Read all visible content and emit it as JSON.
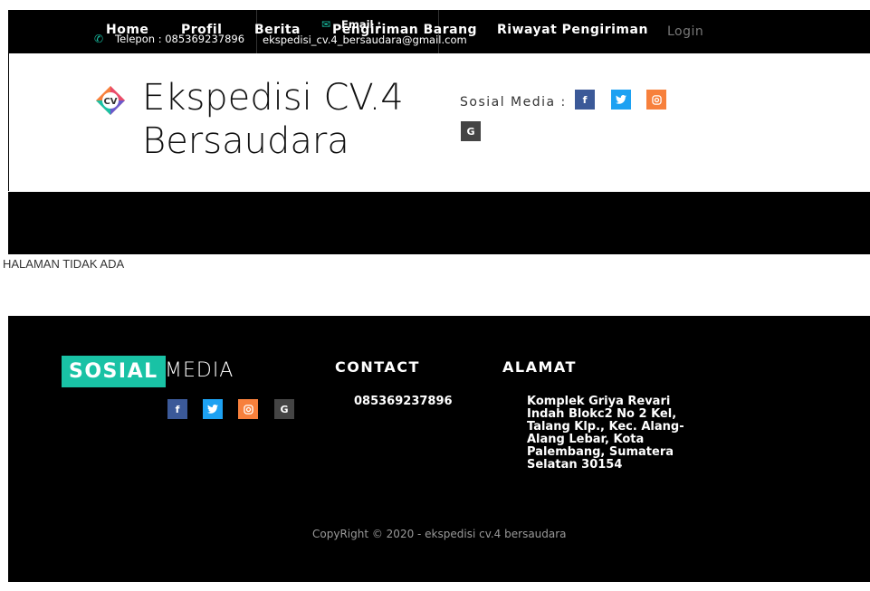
{
  "topbar": {
    "phone_label": "Telepon : 085369237896",
    "email_label": "Email :",
    "email_value": "ekspedisi_cv.4_bersaudara@gmail.com"
  },
  "header": {
    "logo_text": "CV",
    "brand_line1": "Ekspedisi CV.4",
    "brand_line2": "Bersaudara",
    "social_label": "Sosial Media :",
    "social_icons": [
      "f",
      "t",
      "ig",
      "G"
    ]
  },
  "nav": {
    "items": [
      "Home",
      "Profil",
      "Berita",
      "Pengiriman Barang",
      "Riwayat Pengiriman"
    ],
    "login": "Login"
  },
  "content": {
    "message": "HALAMAN TIDAK ADA"
  },
  "footer": {
    "sosial_word": "SOSIAL",
    "media_word": "MEDIA",
    "contact_heading": "CONTACT",
    "contact_phone": "085369237896",
    "alamat_heading": "ALAMAT",
    "alamat_lines": [
      "Komplek Griya Revari",
      "Indah Blokc2 No 2 Kel,",
      "Talang Klp., Kec. Alang-",
      "Alang Lebar, Kota",
      "Palembang, Sumatera",
      "Selatan 30154"
    ],
    "copyright": "CopyRight © 2020 - ekspedisi cv.4 bersaudara"
  },
  "colors": {
    "accent": "#19c2a5",
    "facebook": "#3b5998",
    "twitter": "#1da1f2",
    "instagram": "#f7803c",
    "google": "#444444"
  }
}
